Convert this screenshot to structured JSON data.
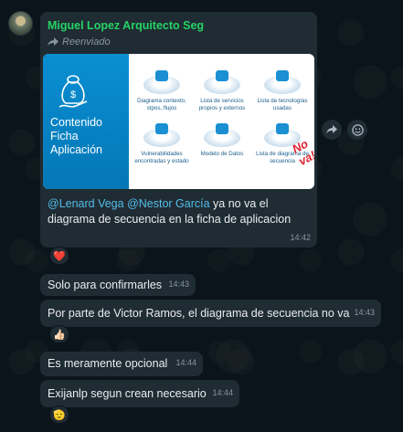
{
  "message": {
    "sender": "Miguel Lopez Arquitecto Seg",
    "forwarded_label": "Reenviado",
    "media": {
      "title": [
        "Contenido",
        "Ficha",
        "Aplicación"
      ],
      "tiles": [
        {
          "label": "Diagrama contexto, stpos, flujos"
        },
        {
          "label": "Lista de servicios propios y externos"
        },
        {
          "label": "Lista de tecnologías usadas"
        },
        {
          "label": "Vulnerabilidades encontradas y estado"
        },
        {
          "label": "Modelo de Datos"
        },
        {
          "label": "Lista de diagrama de secuencia"
        }
      ],
      "stamp": "No va!"
    },
    "mention1": "@Lenard Vega",
    "mention2": "@Nestor García",
    "text": " ya no va el diagrama de secuencia en la ficha de aplicacion",
    "time": "14:42",
    "reaction": "❤️"
  },
  "replies": [
    {
      "text": "Solo para confirmarles",
      "time": "14:43"
    },
    {
      "text": "Por parte de Victor Ramos, el diagrama de secuencia no va",
      "time": "14:43",
      "reaction": "👍🏻"
    },
    {
      "text": "Es meramente opcional",
      "time": "14:44"
    },
    {
      "text": "Exijanlp segun crean necesario",
      "time": "14:44",
      "reaction": "🫡"
    }
  ]
}
